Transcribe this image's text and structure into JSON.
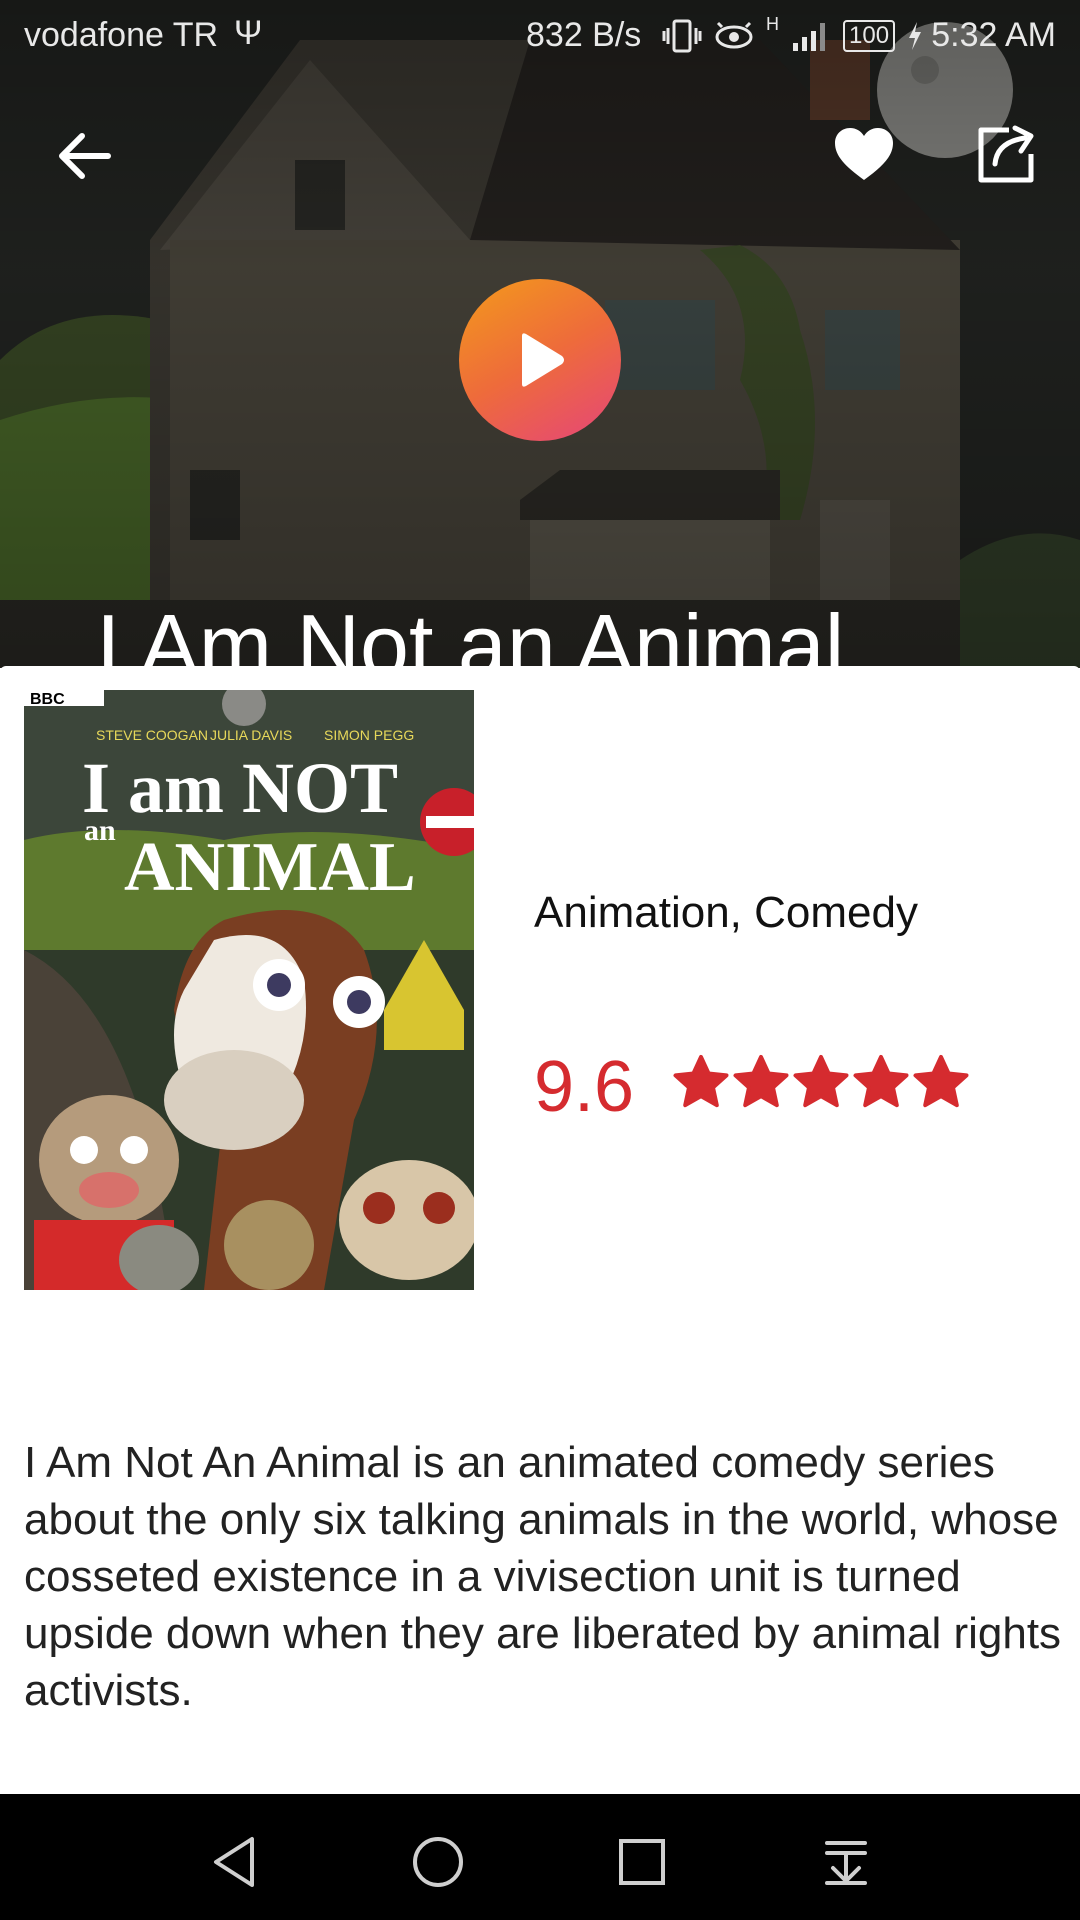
{
  "status_bar": {
    "carrier": "vodafone TR",
    "usb_symbol": "Ψ",
    "network_speed": "832 B/s",
    "network_type": "H",
    "battery": "100",
    "time": "5:32 AM"
  },
  "header": {
    "back_icon": "arrow-left-icon",
    "favorite_icon": "heart-icon",
    "share_icon": "share-icon",
    "play_icon": "play-icon"
  },
  "movie": {
    "title": "I Am Not an Animal",
    "genres": "Animation, Comedy",
    "rating": "9.6",
    "stars": 5,
    "description": "I Am Not An Animal is an animated comedy series about the only six talking animals in the world, whose cosseted existence in a vivisection unit is turned upside down when they are liberated by animal rights activists."
  },
  "poster": {
    "channel": "BBC",
    "cast": [
      "STEVE COOGAN",
      "JULIA DAVIS",
      "SIMON PEGG"
    ],
    "title_line1": "I am NOT",
    "title_line2_small": "an",
    "title_line2": "ANIMAL"
  },
  "colors": {
    "rating_red": "#d52b2f",
    "play_gradient_start": "#f39a1b",
    "play_gradient_end": "#e5457a"
  },
  "nav_bar": {
    "back_icon": "triangle-back-icon",
    "home_icon": "circle-home-icon",
    "recents_icon": "square-recents-icon",
    "extra_icon": "pull-down-icon"
  }
}
